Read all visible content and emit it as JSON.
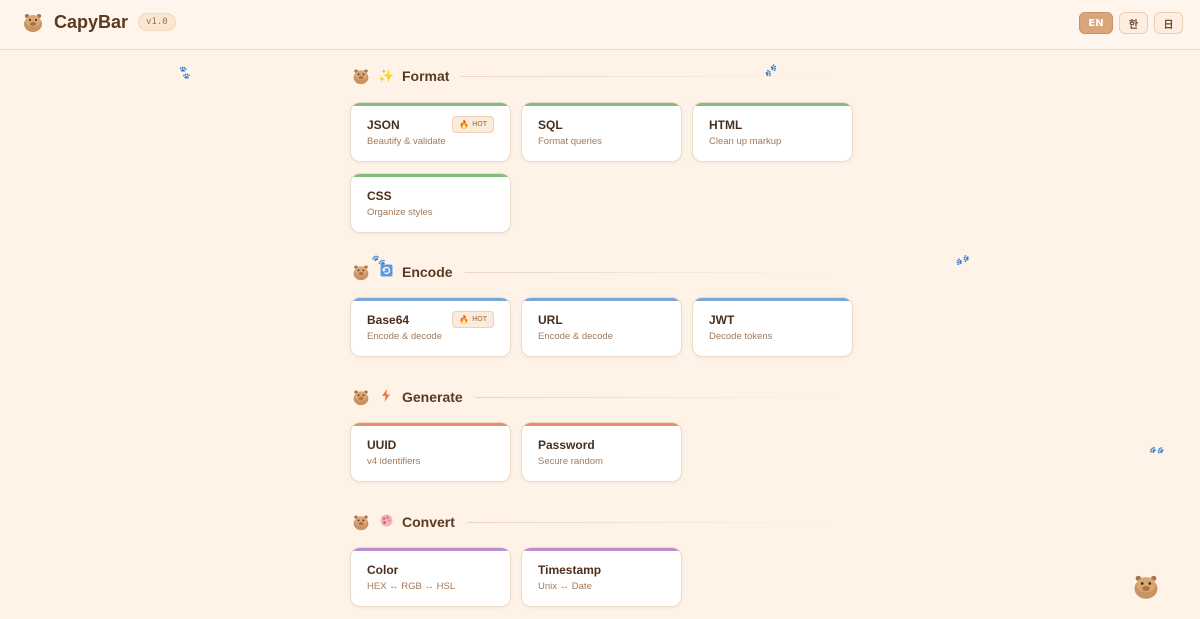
{
  "header": {
    "app_name": "CapyBar",
    "version": "v1.0",
    "languages": [
      {
        "label": "EN",
        "active": true
      },
      {
        "label": "한",
        "active": false
      },
      {
        "label": "日",
        "active": false
      }
    ]
  },
  "sections": [
    {
      "title": "Format",
      "icon": "sparkles-icon",
      "accent": "#7fbf7a",
      "tools": [
        {
          "title": "JSON",
          "desc": "Beautify & validate",
          "badge": "HOT"
        },
        {
          "title": "SQL",
          "desc": "Format queries"
        },
        {
          "title": "HTML",
          "desc": "Clean up markup"
        },
        {
          "title": "CSS",
          "desc": "Organize styles"
        }
      ]
    },
    {
      "title": "Encode",
      "icon": "refresh-icon",
      "accent": "#7aa8d6",
      "tools": [
        {
          "title": "Base64",
          "desc": "Encode & decode",
          "badge": "HOT"
        },
        {
          "title": "URL",
          "desc": "Encode & decode"
        },
        {
          "title": "JWT",
          "desc": "Decode tokens"
        }
      ]
    },
    {
      "title": "Generate",
      "icon": "lightning-icon",
      "accent": "#e8906e",
      "tools": [
        {
          "title": "UUID",
          "desc": "v4 identifiers"
        },
        {
          "title": "Password",
          "desc": "Secure random"
        }
      ]
    },
    {
      "title": "Convert",
      "icon": "palette-icon",
      "accent": "#b88fd0",
      "tools": [
        {
          "title": "Color",
          "desc": "HEX ↔ RGB ↔ HSL"
        },
        {
          "title": "Timestamp",
          "desc": "Unix ↔ Date"
        }
      ]
    }
  ]
}
